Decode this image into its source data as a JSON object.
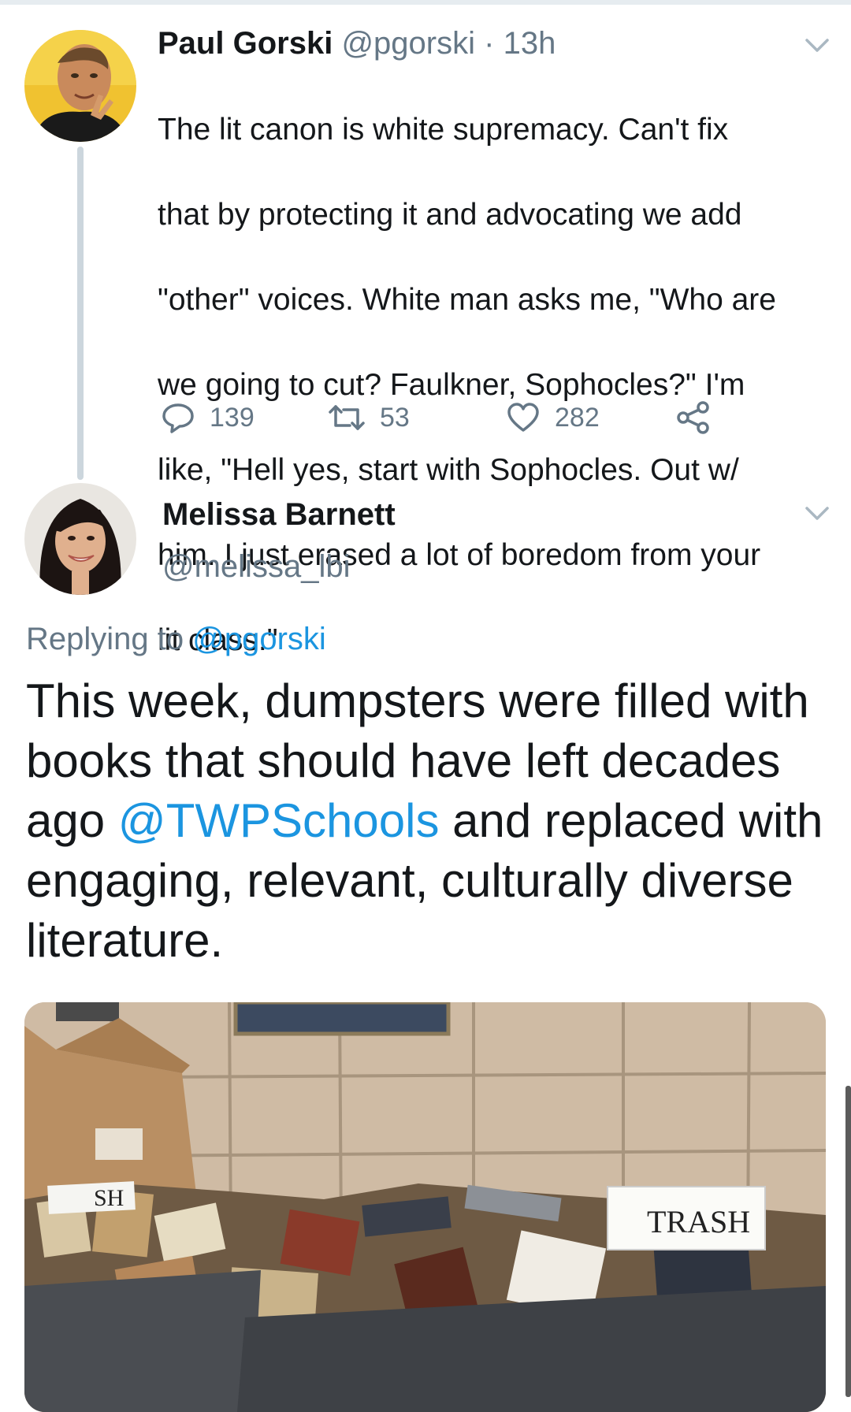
{
  "tweet1": {
    "author_name": "Paul Gorski",
    "handle": "@pgorski",
    "separator": "·",
    "time": "13h",
    "text_lines": [
      "The lit canon is white supremacy. Can't fix",
      "that by protecting it and advocating we add",
      "\"other\" voices. White man asks me, \"Who are",
      "we going to cut? Faulkner, Sophocles?\" I'm",
      "like, \"Hell yes, start with Sophocles. Out w/",
      "him. I just erased a lot of boredom from your",
      "lit class.\""
    ],
    "replies": "139",
    "retweets": "53",
    "likes": "282"
  },
  "tweet2": {
    "author_name": "Melissa Barnett",
    "handle": "@melissa_lbi",
    "replying_prefix": "Replying to",
    "replying_handle": "@pgorski",
    "text_before_mention": "This week, dumpsters were filled with books that should have left decades ago ",
    "mention": "@TWPSchools",
    "text_after_mention": " and replaced with engaging, relevant, culturally diverse literature.",
    "media_sign_left": "SH",
    "media_sign_right": "TRASH"
  },
  "icons": {
    "reply": "reply-icon",
    "retweet": "retweet-icon",
    "like": "heart-icon",
    "share": "share-icon",
    "menu": "chevron-down-icon"
  },
  "colors": {
    "text": "#14171a",
    "muted": "#657786",
    "link": "#1b95e0",
    "thread_line": "#ccd6dd"
  }
}
